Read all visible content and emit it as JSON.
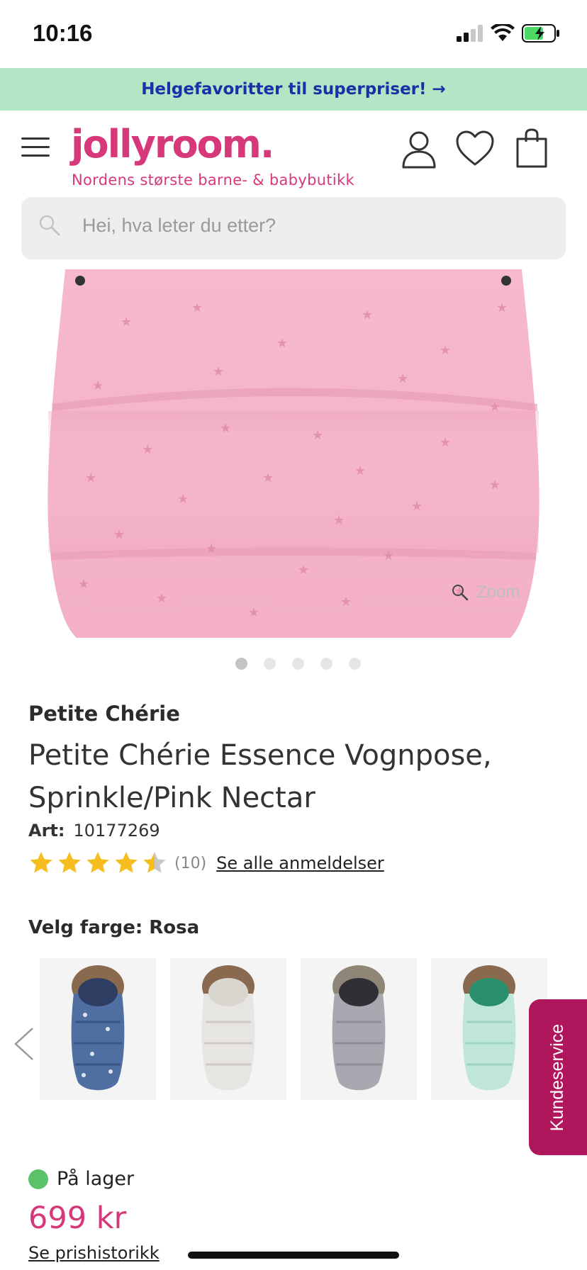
{
  "status": {
    "time": "10:16"
  },
  "promo": {
    "text": "Helgefavoritter til superpriser! →"
  },
  "header": {
    "logo": "jollyroom.",
    "tagline": "Nordens største barne- & babybutikk"
  },
  "search": {
    "placeholder": "Hei, hva leter du etter?"
  },
  "gallery": {
    "zoom_label": "Zoom",
    "slide_count": 5,
    "active_slide": 1
  },
  "product": {
    "brand": "Petite Chérie",
    "title": "Petite Chérie Essence Vognpose, Sprinkle/Pink Nectar",
    "art_label": "Art:",
    "art_number": "10177269",
    "rating_value": 4.5,
    "rating_max": 5,
    "review_count": "(10)",
    "reviews_link": "Se alle anmeldelser"
  },
  "color_select": {
    "label": "Velg farge: Rosa",
    "options": [
      {
        "name": "blue",
        "color": "#4f6fa3"
      },
      {
        "name": "white",
        "color": "#e7e5e1"
      },
      {
        "name": "grey",
        "color": "#a9a7b0"
      },
      {
        "name": "mint",
        "color": "#bfe6d9"
      }
    ]
  },
  "customer_service": {
    "label": "Kundeservice"
  },
  "stock": {
    "text": "På lager",
    "color": "#5cc26a"
  },
  "price": {
    "value": "699 kr",
    "history_link": "Se prishistorikk"
  },
  "colors": {
    "brand": "#d6387a",
    "promo_bg": "#b3e6c4",
    "promo_text": "#1a2fa8",
    "service_bg": "#b0165c"
  }
}
